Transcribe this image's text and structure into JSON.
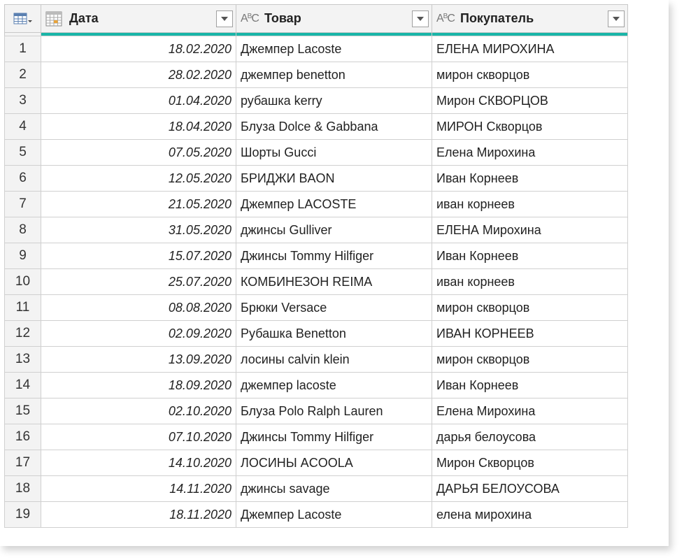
{
  "columns": {
    "date": {
      "label": "Дата",
      "type_icon": "calendar-icon"
    },
    "item": {
      "label": "Товар",
      "type_icon": "text-type-icon",
      "type_text": "ABC"
    },
    "buyer": {
      "label": "Покупатель",
      "type_icon": "text-type-icon",
      "type_text": "ABC"
    }
  },
  "colors": {
    "quality_bar": "#19b5a8",
    "header_bg": "#f3f3f3",
    "grid_line": "#d0d0d0"
  },
  "rows": [
    {
      "n": "1",
      "date": "18.02.2020",
      "item": "Джемпер Lacoste",
      "buyer": "ЕЛЕНА МИРОХИНА"
    },
    {
      "n": "2",
      "date": "28.02.2020",
      "item": "джемпер benetton",
      "buyer": "мирон скворцов"
    },
    {
      "n": "3",
      "date": "01.04.2020",
      "item": "рубашка kerry",
      "buyer": "Мирон СКВОРЦОВ"
    },
    {
      "n": "4",
      "date": "18.04.2020",
      "item": "Блуза Dolce & Gabbana",
      "buyer": "МИРОН Скворцов"
    },
    {
      "n": "5",
      "date": "07.05.2020",
      "item": "Шорты Gucci",
      "buyer": "Елена Мирохина"
    },
    {
      "n": "6",
      "date": "12.05.2020",
      "item": "БРИДЖИ BAON",
      "buyer": "Иван Корнеев"
    },
    {
      "n": "7",
      "date": "21.05.2020",
      "item": "Джемпер LACOSTE",
      "buyer": "иван корнеев"
    },
    {
      "n": "8",
      "date": "31.05.2020",
      "item": "джинсы Gulliver",
      "buyer": "ЕЛЕНА Мирохина"
    },
    {
      "n": "9",
      "date": "15.07.2020",
      "item": "Джинсы Tommy Hilfiger",
      "buyer": "Иван Корнеев"
    },
    {
      "n": "10",
      "date": "25.07.2020",
      "item": "КОМБИНЕЗОН REIMA",
      "buyer": "иван корнеев"
    },
    {
      "n": "11",
      "date": "08.08.2020",
      "item": "Брюки Versace",
      "buyer": "мирон скворцов"
    },
    {
      "n": "12",
      "date": "02.09.2020",
      "item": "Рубашка Benetton",
      "buyer": "ИВАН КОРНЕЕВ"
    },
    {
      "n": "13",
      "date": "13.09.2020",
      "item": "лосины calvin klein",
      "buyer": "мирон скворцов"
    },
    {
      "n": "14",
      "date": "18.09.2020",
      "item": "джемпер lacoste",
      "buyer": "Иван Корнеев"
    },
    {
      "n": "15",
      "date": "02.10.2020",
      "item": "Блуза Polo Ralph Lauren",
      "buyer": "Елена Мирохина"
    },
    {
      "n": "16",
      "date": "07.10.2020",
      "item": "Джинсы Tommy Hilfiger",
      "buyer": "дарья белоусова"
    },
    {
      "n": "17",
      "date": "14.10.2020",
      "item": "ЛОСИНЫ ACOOLA",
      "buyer": "Мирон Скворцов"
    },
    {
      "n": "18",
      "date": "14.11.2020",
      "item": "джинсы savage",
      "buyer": "ДАРЬЯ БЕЛОУСОВА"
    },
    {
      "n": "19",
      "date": "18.11.2020",
      "item": "Джемпер Lacoste",
      "buyer": "елена мирохина"
    }
  ]
}
